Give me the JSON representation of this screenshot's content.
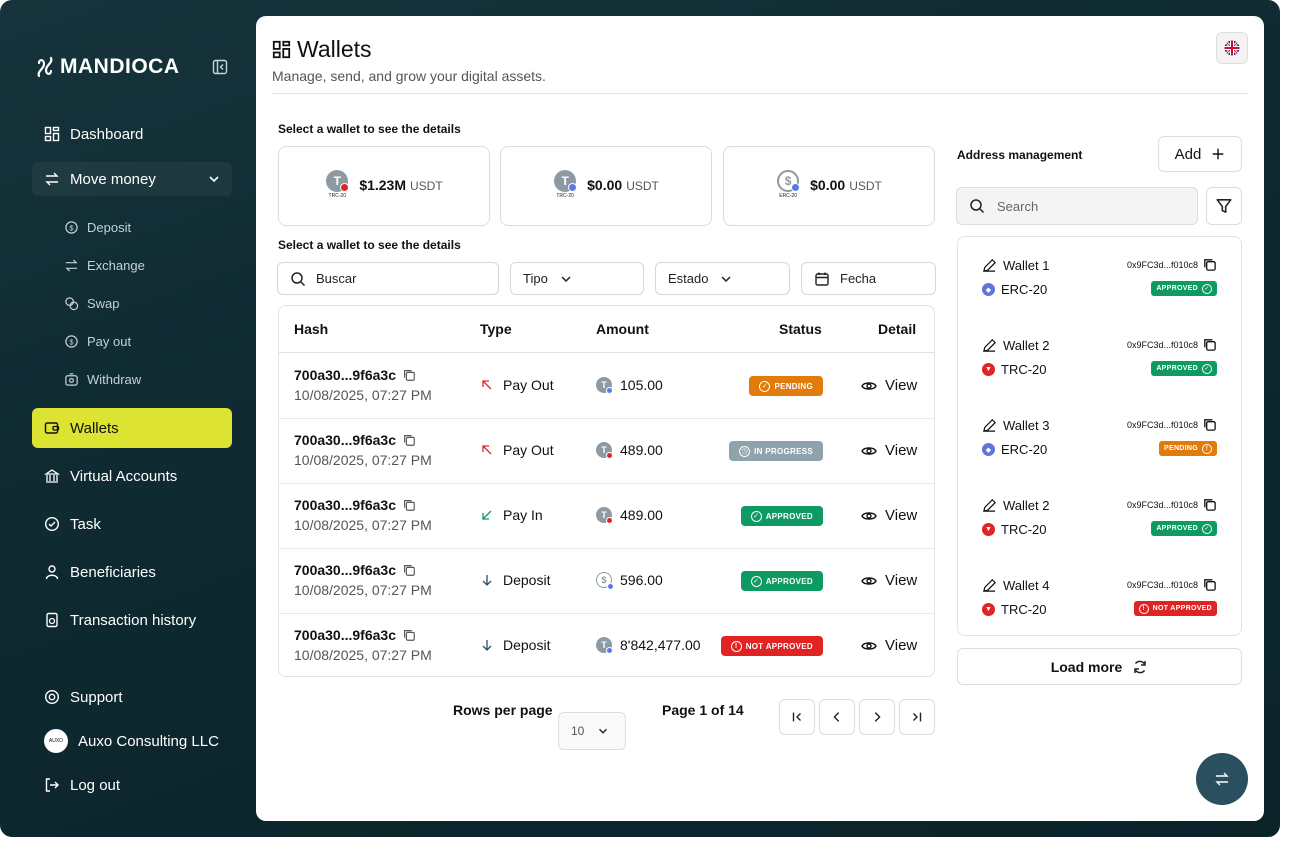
{
  "app": {
    "brand": "MANDIOCA"
  },
  "colors": {
    "sidebar_bg": "#0f2a31",
    "active": "#dce431",
    "pending": "#e07b0c",
    "in_progress": "#8fa3ad",
    "approved": "#0e9a63",
    "not_approved": "#e02424"
  },
  "sidebar": {
    "dashboard": "Dashboard",
    "move_money": "Move money",
    "sub": {
      "deposit": "Deposit",
      "exchange": "Exchange",
      "swap": "Swap",
      "payout": "Pay out",
      "withdraw": "Withdraw"
    },
    "wallets": "Wallets",
    "virtual_accounts": "Virtual Accounts",
    "task": "Task",
    "beneficiaries": "Beneficiaries",
    "history": "Transaction history",
    "support": "Support",
    "company": "Auxo Consulting LLC",
    "company_avatar": "AUXO",
    "logout": "Log out"
  },
  "page": {
    "title": "Wallets",
    "subtitle": "Manage, send, and grow your digital assets."
  },
  "wallets": {
    "label": "Select a wallet to see the details",
    "cards": [
      {
        "amount": "$1.23M",
        "currency": "USDT",
        "network": "TRC-20",
        "symbol": "T"
      },
      {
        "amount": "$0.00",
        "currency": "USDT",
        "network": "TRC-20",
        "symbol": "T"
      },
      {
        "amount": "$0.00",
        "currency": "USDT",
        "network": "ERC-20",
        "symbol": "$"
      }
    ]
  },
  "filters": {
    "label": "Select a wallet to see the details",
    "search_placeholder": "Buscar",
    "type": "Tipo",
    "status": "Estado",
    "date": "Fecha"
  },
  "table": {
    "headers": {
      "hash": "Hash",
      "type": "Type",
      "amount": "Amount",
      "status": "Status",
      "detail": "Detail"
    },
    "view_label": "View",
    "rows": [
      {
        "hash": "700a30...9f6a3c",
        "date": "10/08/2025, 07:27 PM",
        "type": "Pay Out",
        "amount": "105.00",
        "status": "PENDING"
      },
      {
        "hash": "700a30...9f6a3c",
        "date": "10/08/2025, 07:27 PM",
        "type": "Pay Out",
        "amount": "489.00",
        "status": "IN PROGRESS"
      },
      {
        "hash": "700a30...9f6a3c",
        "date": "10/08/2025, 07:27 PM",
        "type": "Pay In",
        "amount": "489.00",
        "status": "APPROVED"
      },
      {
        "hash": "700a30...9f6a3c",
        "date": "10/08/2025, 07:27 PM",
        "type": "Deposit",
        "amount": "596.00",
        "status": "APPROVED"
      },
      {
        "hash": "700a30...9f6a3c",
        "date": "10/08/2025, 07:27 PM",
        "type": "Deposit",
        "amount": "8'842,477.00",
        "status": "NOT APPROVED"
      }
    ]
  },
  "pagination": {
    "rows_per_page_label": "Rows per page",
    "rows_per_page": "10",
    "page_text": "Page 1 of 14"
  },
  "address": {
    "title": "Address management",
    "add_label": "Add",
    "search_placeholder": "Search",
    "items": [
      {
        "name": "Wallet 1",
        "address": "0x9FC3d...f010c8",
        "network": "ERC-20",
        "status": "APPROVED"
      },
      {
        "name": "Wallet 2",
        "address": "0x9FC3d...f010c8",
        "network": "TRC-20",
        "status": "APPROVED"
      },
      {
        "name": "Wallet 3",
        "address": "0x9FC3d...f010c8",
        "network": "ERC-20",
        "status": "PENDING"
      },
      {
        "name": "Wallet 2",
        "address": "0x9FC3d...f010c8",
        "network": "TRC-20",
        "status": "APPROVED"
      },
      {
        "name": "Wallet 4",
        "address": "0x9FC3d...f010c8",
        "network": "TRC-20",
        "status": "NOT APPROVED"
      }
    ],
    "load_more": "Load more"
  }
}
